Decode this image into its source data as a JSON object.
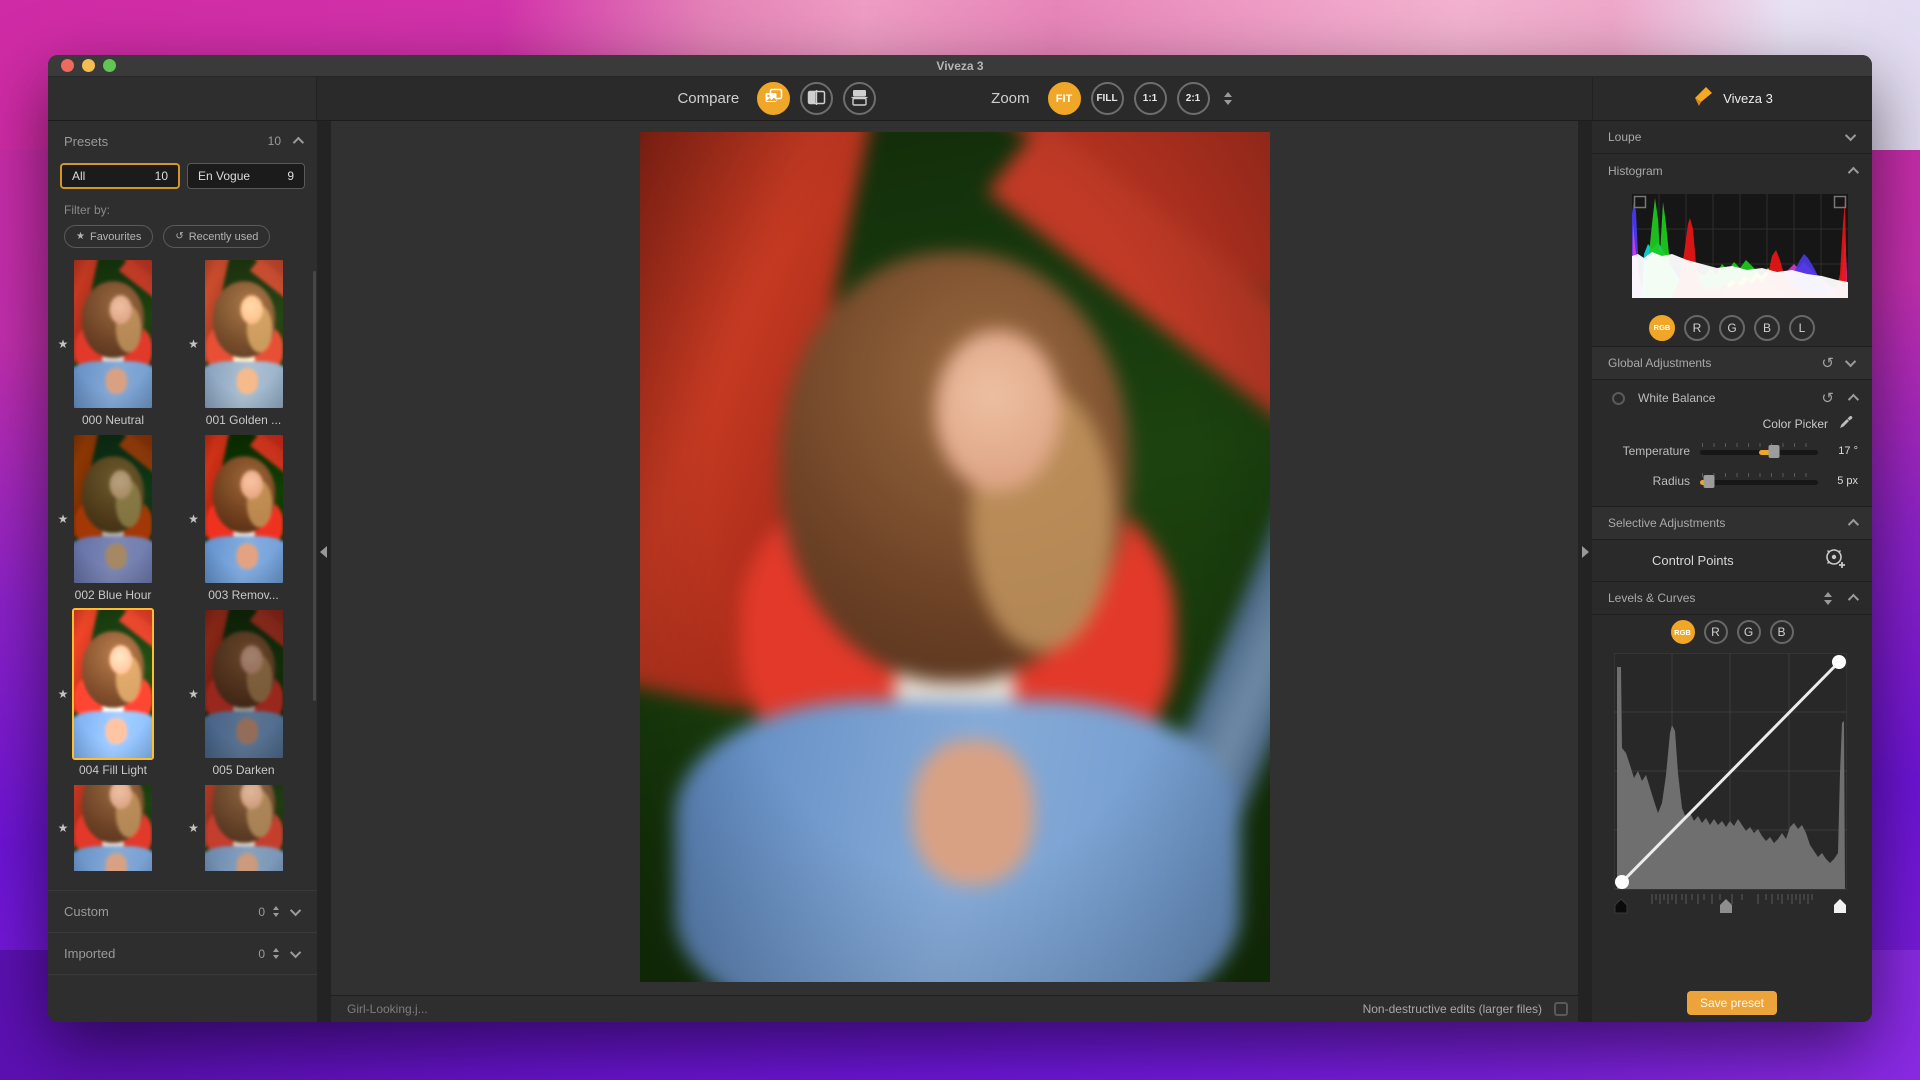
{
  "window": {
    "title": "Viveza 3"
  },
  "toolbar": {
    "compare_label": "Compare",
    "zoom_label": "Zoom",
    "zoom_fit": "FIT",
    "zoom_fill": "FILL",
    "zoom_1_1": "1:1",
    "zoom_2_1": "2:1"
  },
  "sidebar": {
    "header": "Presets",
    "count": "10",
    "tab_all": {
      "label": "All",
      "count": "10"
    },
    "tab_envogue": {
      "label": "En Vogue",
      "count": "9"
    },
    "filter_by": "Filter by:",
    "filter_favourites": "Favourites",
    "filter_recent": "Recently used",
    "presets": [
      {
        "label": "000 Neutral"
      },
      {
        "label": "001 Golden ..."
      },
      {
        "label": "002 Blue Hour"
      },
      {
        "label": "003 Remov..."
      },
      {
        "label": "004 Fill Light"
      },
      {
        "label": "005 Darken"
      },
      {
        "label": ""
      },
      {
        "label": ""
      }
    ],
    "custom": {
      "label": "Custom",
      "count": "0"
    },
    "imported": {
      "label": "Imported",
      "count": "0"
    }
  },
  "statusbar": {
    "filename": "Girl-Looking.j...",
    "nondestructive": "Non-destructive edits (larger files)"
  },
  "panel": {
    "title": "Viveza 3",
    "loupe": "Loupe",
    "histogram": "Histogram",
    "hist_channels": [
      "RGB",
      "R",
      "G",
      "B",
      "L"
    ],
    "global_adjustments": "Global Adjustments",
    "white_balance": "White Balance",
    "color_picker": "Color Picker",
    "temperature_label": "Temperature",
    "temperature_value": "17 °",
    "radius_label": "Radius",
    "radius_value": "5 px",
    "selective_adjustments": "Selective Adjustments",
    "control_points": "Control Points",
    "levels_curves": "Levels & Curves",
    "curve_channels": [
      "RGB",
      "R",
      "G",
      "B"
    ],
    "save_preset": "Save preset"
  },
  "colors": {
    "accent": "#f0a626",
    "selection_border": "#e79b27"
  }
}
